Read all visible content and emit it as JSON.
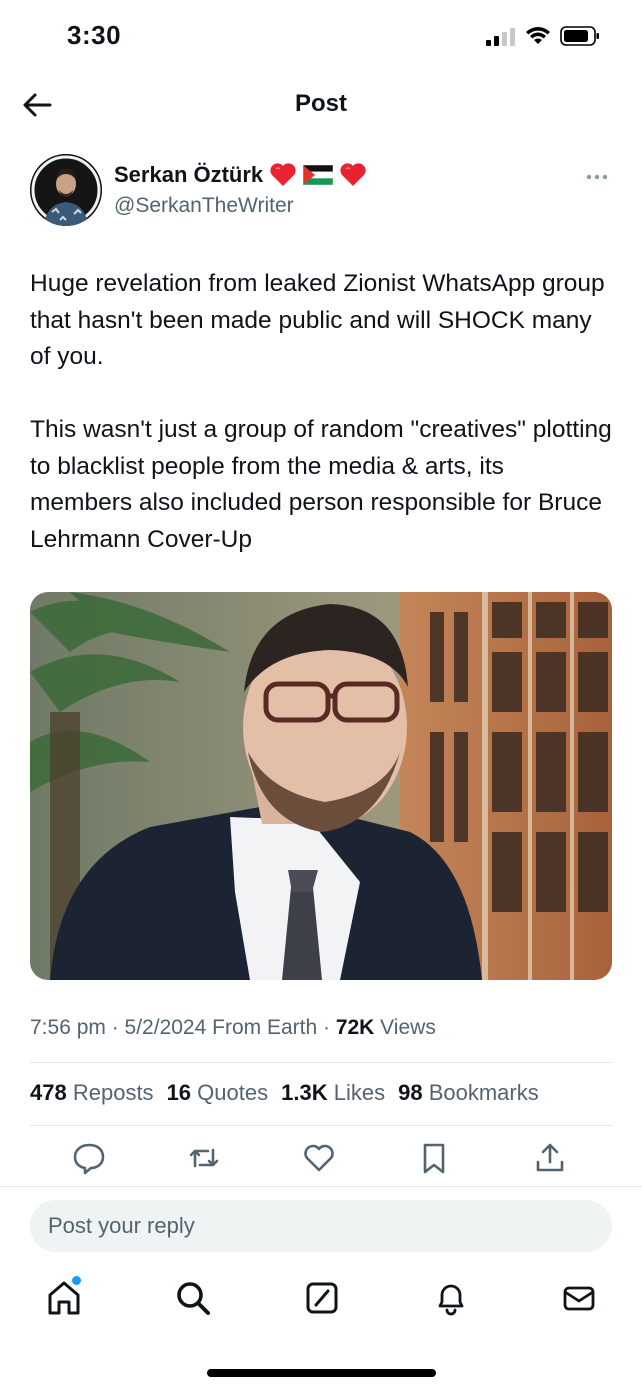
{
  "status_bar": {
    "time": "3:30",
    "icons": [
      "signal-icon",
      "wifi-icon",
      "battery-icon"
    ]
  },
  "nav": {
    "title": "Post",
    "back_icon": "arrow-left-icon"
  },
  "author": {
    "name": "Serkan Öztürk",
    "name_emojis": [
      "red-heart",
      "palestine-flag",
      "red-heart"
    ],
    "handle": "@SerkanTheWriter",
    "more_icon": "more-horizontal-icon"
  },
  "tweet": {
    "text": "Huge revelation from leaked Zionist WhatsApp group that hasn't been made public and will SHOCK many of you.\n\nThis wasn't just a group of random \"creatives\" plotting to blacklist people from the media & arts, its members also included person responsible for Bruce Lehrmann Cover-Up"
  },
  "meta": {
    "time_date_source": "7:56 pm · 5/2/2024 From Earth · ",
    "views_count": "72K",
    "views_label": " Views"
  },
  "stats": [
    {
      "count": "478",
      "label": "Reposts"
    },
    {
      "count": "16",
      "label": "Quotes"
    },
    {
      "count": "1.3K",
      "label": "Likes"
    },
    {
      "count": "98",
      "label": "Bookmarks"
    }
  ],
  "actions": [
    "reply-icon",
    "repost-icon",
    "like-icon",
    "bookmark-icon",
    "share-icon"
  ],
  "reply": {
    "placeholder": "Post your reply"
  },
  "tabbar": [
    "home-icon",
    "search-icon",
    "grok-icon",
    "notifications-icon",
    "messages-icon"
  ],
  "colors": {
    "text": "#0f1419",
    "secondary": "#536471",
    "accent": "#1d9bf0",
    "reply_bg": "#eff3f4",
    "divider": "#e3e6e9"
  }
}
